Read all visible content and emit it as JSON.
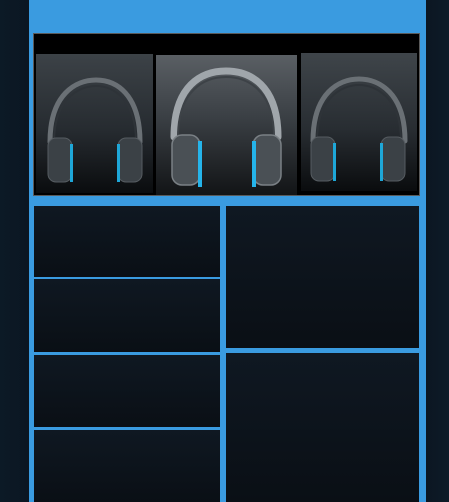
{
  "app": {
    "accent_color": "#3a9be0",
    "background_color": "#0a1119"
  },
  "carousel": {
    "items": [
      {
        "icon": "headphones-icon",
        "state": "side"
      },
      {
        "icon": "headphones-icon",
        "state": "selected"
      },
      {
        "icon": "headphones-icon",
        "state": "side"
      }
    ]
  },
  "grid": {
    "left_tiles": 4,
    "right_tiles": 2
  }
}
